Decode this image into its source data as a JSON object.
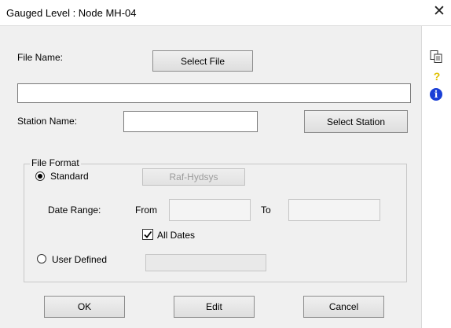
{
  "dialog": {
    "title": "Gauged Level : Node MH-04",
    "close_glyph": "✕"
  },
  "file": {
    "label": "File Name:",
    "select_button": "Select File",
    "path_value": ""
  },
  "station": {
    "label": "Station Name:",
    "value": "",
    "select_button": "Select Station"
  },
  "file_format": {
    "legend": "File Format",
    "standard_label": "Standard",
    "standard_selected": true,
    "format_button": "Raf-Hydsys",
    "date_range_label": "Date Range:",
    "from_label": "From",
    "from_value": "",
    "to_label": "To",
    "to_value": "",
    "all_dates_label": "All Dates",
    "all_dates_checked": true,
    "user_defined_label": "User Defined",
    "user_defined_selected": false,
    "user_defined_value": ""
  },
  "buttons": {
    "ok": "OK",
    "edit": "Edit",
    "cancel": "Cancel"
  },
  "sidebar": {
    "icons": [
      "copy-icon",
      "help-icon",
      "info-icon"
    ],
    "help_glyph": "?",
    "info_glyph": "i"
  }
}
